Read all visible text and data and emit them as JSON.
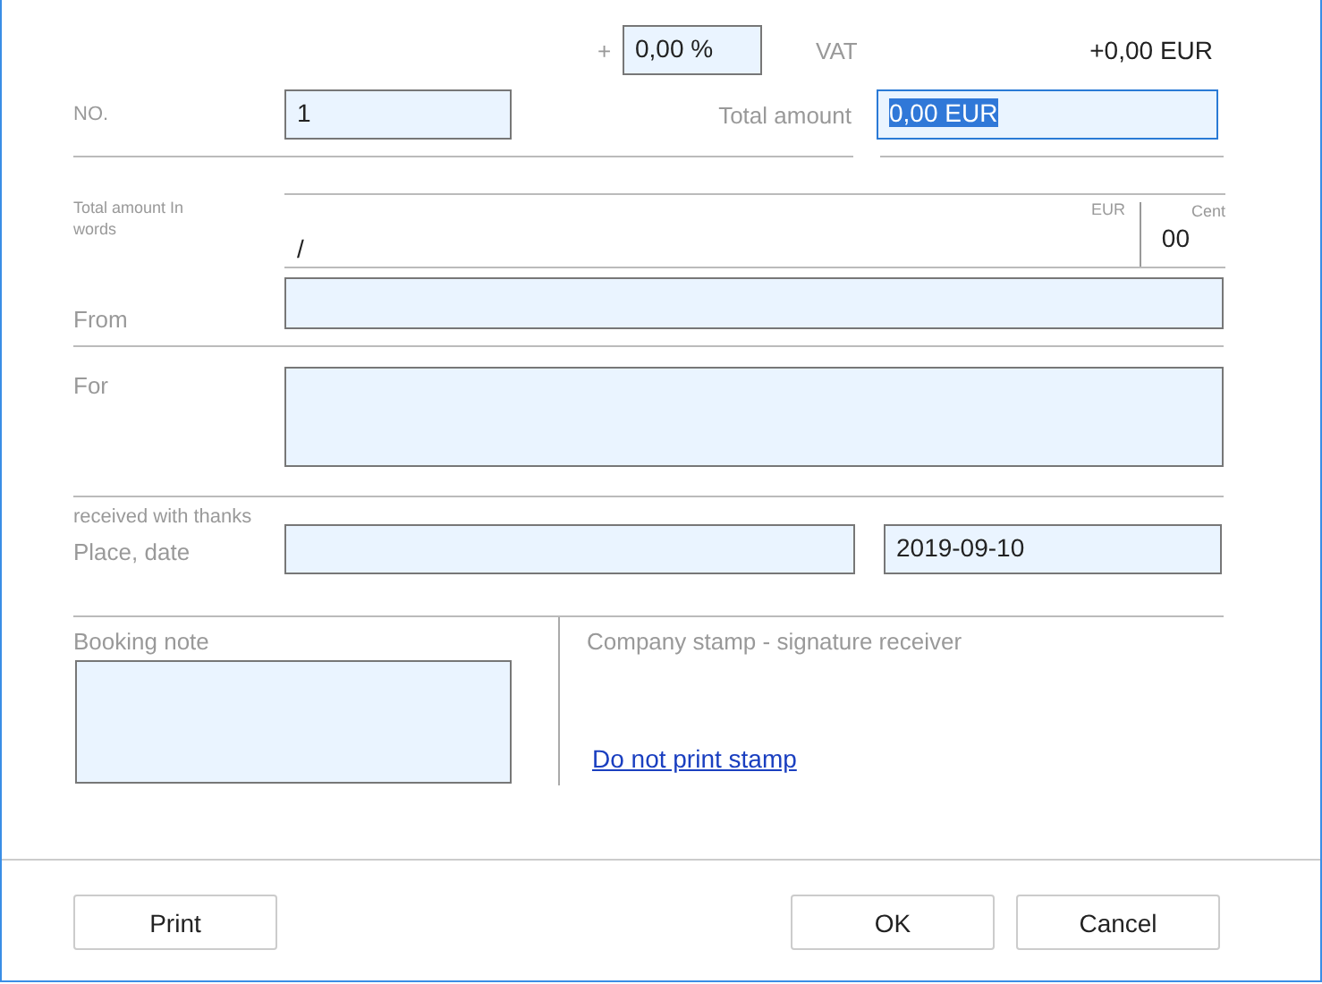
{
  "vat": {
    "sign": "+",
    "rate": "0,00 %",
    "label": "VAT",
    "amount": "+0,00 EUR"
  },
  "number": {
    "label": "NO.",
    "value": "1"
  },
  "total": {
    "label": "Total amount",
    "value": "0,00 EUR",
    "selected": true
  },
  "in_words": {
    "label": "Total amount In words",
    "currency": "EUR",
    "cent_label": "Cent",
    "value": "/",
    "cents": "00"
  },
  "from": {
    "label": "From"
  },
  "for": {
    "label": "For"
  },
  "place_date": {
    "note": "received with thanks",
    "label": "Place, date",
    "date": "2019-09-10"
  },
  "booking_note": {
    "label": "Booking note"
  },
  "stamp": {
    "label": "Company stamp - signature receiver",
    "link": "Do not print stamp"
  },
  "buttons_left": [
    {
      "label": "Print"
    }
  ],
  "buttons_right": [
    {
      "label": "OK"
    },
    {
      "label": "Cancel"
    }
  ]
}
